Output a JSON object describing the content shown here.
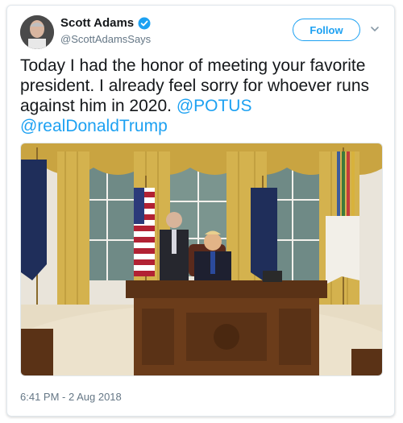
{
  "author": {
    "name": "Scott Adams",
    "handle": "@ScottAdamsSays",
    "verified": true
  },
  "follow_label": "Follow",
  "tweet": {
    "text": "Today I had the honor of meeting your favorite president. I already feel sorry for whoever runs against him in 2020.",
    "mentions": [
      "@POTUS",
      "@realDonaldTrump"
    ]
  },
  "timestamp": "6:41 PM - 2 Aug 2018",
  "colors": {
    "accent": "#1da1f2",
    "text": "#14171a",
    "muted": "#657786",
    "border": "#e1e8ed"
  },
  "icons": [
    "verified-badge-icon",
    "chevron-down-icon"
  ]
}
